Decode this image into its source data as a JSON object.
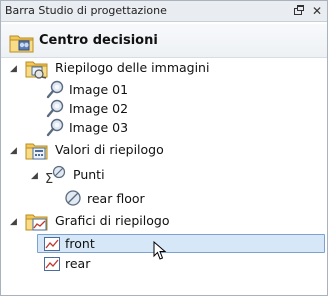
{
  "panel": {
    "title": "Barra Studio di progettazione",
    "pin_icon": "pin-icon",
    "close_symbol": "✕"
  },
  "tree": {
    "root": {
      "label": "Centro decisioni",
      "icon": "decision-center-icon"
    },
    "images_summary": {
      "label": "Riepilogo delle immagini",
      "icon": "image-folder-icon",
      "items": [
        {
          "label": "Image 01",
          "icon": "image-probe-icon"
        },
        {
          "label": "Image 02",
          "icon": "image-probe-icon"
        },
        {
          "label": "Image 03",
          "icon": "image-probe-icon"
        }
      ]
    },
    "summary_values": {
      "label": "Valori di riepilogo",
      "icon": "calculator-folder-icon",
      "points": {
        "label": "Punti",
        "icon": "sigma-points-icon",
        "items": [
          {
            "label": "rear floor",
            "icon": "point-value-icon"
          }
        ]
      }
    },
    "summary_charts": {
      "label": "Grafici di riepilogo",
      "icon": "chart-folder-icon",
      "items": [
        {
          "label": "front",
          "icon": "chart-icon",
          "selected": true
        },
        {
          "label": "rear",
          "icon": "chart-icon",
          "selected": false
        }
      ]
    }
  },
  "colors": {
    "selection_fill": "#d6e7f7",
    "selection_border": "#7da2ce",
    "folder": "#f2c75c"
  }
}
